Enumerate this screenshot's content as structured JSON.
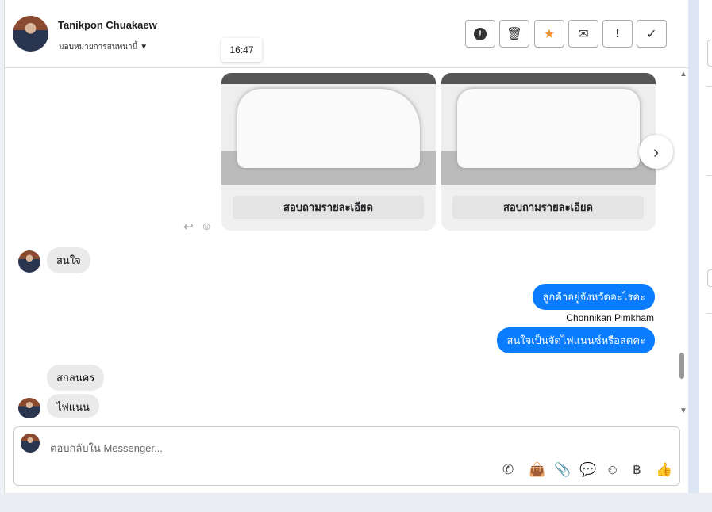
{
  "header": {
    "name": "Tanikpon Chuakaew",
    "assign_label": "มอบหมายการสนทนานี้",
    "tooltip_time": "16:47",
    "actions": [
      {
        "name": "spam",
        "glyph": "⓿"
      },
      {
        "name": "delete",
        "glyph": "🗑"
      },
      {
        "name": "star",
        "glyph": "★"
      },
      {
        "name": "mark-unread",
        "glyph": "✉"
      },
      {
        "name": "important",
        "glyph": "!"
      },
      {
        "name": "done",
        "glyph": "✓"
      }
    ]
  },
  "cards": [
    {
      "button": "สอบถามรายละเอียด"
    },
    {
      "button": "สอบถามรายละเอียด"
    }
  ],
  "messages": [
    {
      "from": "customer",
      "text": "สนใจ"
    },
    {
      "from": "agent",
      "text": "ลูกค้าอยู่จังหวัดอะไรคะ"
    },
    {
      "sender_name": "Chonnikan Pimkham"
    },
    {
      "from": "agent",
      "text": "สนใจเป็นจัดไฟแนนซ์หรือสดคะ"
    },
    {
      "from": "customer",
      "text": "สกลนคร"
    },
    {
      "from": "customer",
      "text": "ไฟแนน"
    }
  ],
  "composer": {
    "placeholder": "ตอบกลับใน Messenger..."
  },
  "colors": {
    "accent": "#0a7cff",
    "star": "#f5922f"
  }
}
